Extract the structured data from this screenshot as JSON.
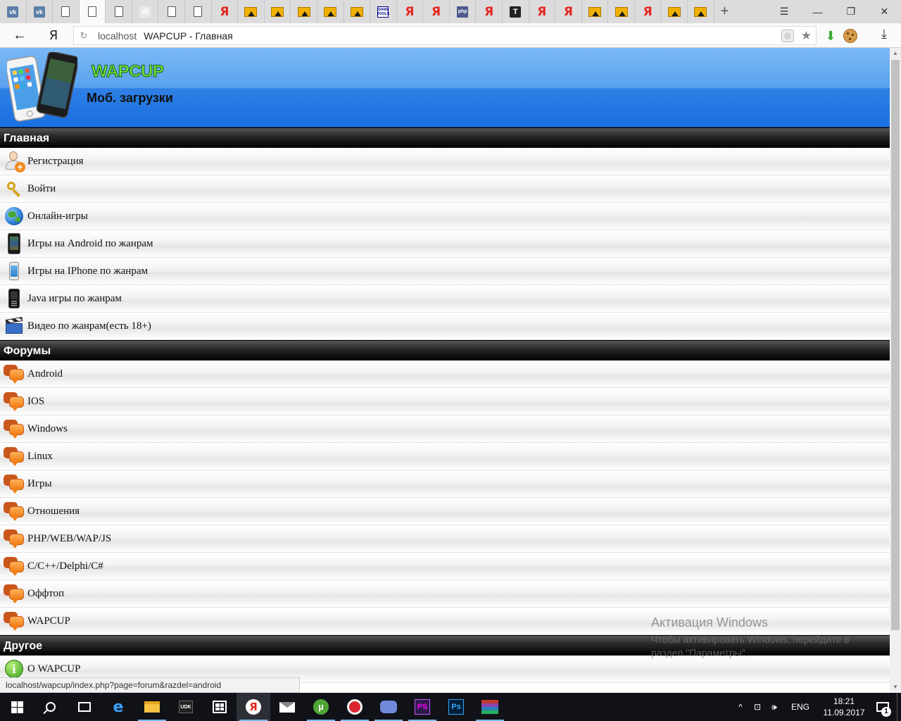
{
  "browser": {
    "tabs": [
      {
        "icon": "vk-icon",
        "glyph": "vk"
      },
      {
        "icon": "vk-icon",
        "glyph": "vk"
      },
      {
        "icon": "document-icon"
      },
      {
        "icon": "document-icon",
        "active": true
      },
      {
        "icon": "document-icon"
      },
      {
        "icon": "w-icon",
        "glyph": "W"
      },
      {
        "icon": "document-icon"
      },
      {
        "icon": "document-icon"
      },
      {
        "icon": "yandex-icon",
        "glyph": "Я"
      },
      {
        "icon": "image-icon"
      },
      {
        "icon": "image-icon"
      },
      {
        "icon": "image-icon"
      },
      {
        "icon": "image-icon"
      },
      {
        "icon": "image-icon"
      },
      {
        "icon": "devtools-icon",
        "glyph": "DANS TOOLS"
      },
      {
        "icon": "yandex-icon",
        "glyph": "Я"
      },
      {
        "icon": "yandex-icon",
        "glyph": "Я"
      },
      {
        "icon": "php-icon",
        "glyph": "php"
      },
      {
        "icon": "yandex-icon",
        "glyph": "Я"
      },
      {
        "icon": "t-icon",
        "glyph": "T"
      },
      {
        "icon": "yandex-icon",
        "glyph": "Я"
      },
      {
        "icon": "yandex-icon",
        "glyph": "Я"
      },
      {
        "icon": "image-icon"
      },
      {
        "icon": "image-icon"
      },
      {
        "icon": "yandex-icon",
        "glyph": "Я"
      },
      {
        "icon": "image-icon"
      },
      {
        "icon": "image-icon"
      }
    ],
    "new_tab": "+",
    "window_buttons": {
      "menu": "☰",
      "minimize": "—",
      "restore": "❐",
      "close": "✕"
    },
    "back": "←",
    "logo": "Я",
    "url_host": "localhost",
    "url_title": "WAPCUP - Главная",
    "status_url": "localhost/wapcup/index.php?page=forum&razdel=android"
  },
  "site": {
    "title": "WAPCUP",
    "subtitle": "Моб. загрузки",
    "sections": [
      {
        "title": "Главная",
        "items": [
          {
            "label": "Регистрация",
            "icon": "user-add-icon"
          },
          {
            "label": "Войти",
            "icon": "key-icon"
          },
          {
            "label": "Онлайн-игры",
            "icon": "globe-icon"
          },
          {
            "label": "Игры на Android по жанрам",
            "icon": "android-phone-icon"
          },
          {
            "label": "Игры на IPhone по жанрам",
            "icon": "iphone-icon"
          },
          {
            "label": "Java игры по жанрам",
            "icon": "java-phone-icon"
          },
          {
            "label": "Видео по жанрам(есть 18+)",
            "icon": "clapperboard-icon"
          }
        ]
      },
      {
        "title": "Форумы",
        "items": [
          {
            "label": "Android",
            "icon": "chat-icon"
          },
          {
            "label": "IOS",
            "icon": "chat-icon"
          },
          {
            "label": "Windows",
            "icon": "chat-icon"
          },
          {
            "label": "Linux",
            "icon": "chat-icon"
          },
          {
            "label": "Игры",
            "icon": "chat-icon"
          },
          {
            "label": "Отношения",
            "icon": "chat-icon"
          },
          {
            "label": "PHP/WEB/WAP/JS",
            "icon": "chat-icon"
          },
          {
            "label": "C/C++/Delphi/C#",
            "icon": "chat-icon"
          },
          {
            "label": "Оффтоп",
            "icon": "chat-icon"
          },
          {
            "label": "WAPCUP",
            "icon": "chat-icon"
          }
        ]
      },
      {
        "title": "Другое",
        "items": [
          {
            "label": "О WAPCUP",
            "icon": "info-icon"
          }
        ]
      }
    ]
  },
  "watermark": {
    "title": "Активация Windows",
    "line1": "Чтобы активировать Windows, перейдите в",
    "line2": "раздел \"Параметры\"."
  },
  "taskbar": {
    "language": "ENG",
    "time": "18:21",
    "date": "11.09.2017",
    "udk_label": "UDK",
    "torrent_label": "µ",
    "ps_label": "PS",
    "photoshop_label": "Ps",
    "edge_label": "e",
    "yandex_label": "Я",
    "notifications": "1",
    "tray_up": "^",
    "tray_network": "⊡",
    "tray_volume": "🕪"
  }
}
